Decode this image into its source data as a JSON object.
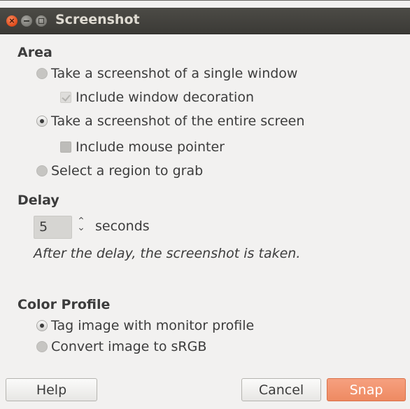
{
  "window": {
    "title": "Screenshot",
    "controls": {
      "close_glyph": "×",
      "close": "close-icon",
      "minimize": "minimize-icon",
      "maximize": "maximize-icon"
    }
  },
  "area": {
    "heading": "Area",
    "options": [
      {
        "label": "Take a screenshot of a single window",
        "type": "radio",
        "selected": false,
        "enabled": true
      },
      {
        "label": "Include window decoration",
        "type": "checkbox",
        "checked": true,
        "enabled": false
      },
      {
        "label": "Take a screenshot of the entire screen",
        "type": "radio",
        "selected": true,
        "enabled": true
      },
      {
        "label": "Include mouse pointer",
        "type": "checkbox",
        "checked": false,
        "enabled": true
      },
      {
        "label": "Select a region to grab",
        "type": "radio",
        "selected": false,
        "enabled": true
      }
    ]
  },
  "delay": {
    "heading": "Delay",
    "value": "5",
    "unit": "seconds",
    "spin_glyph": "⌃⌄",
    "note": "After the delay, the screenshot is taken."
  },
  "color_profile": {
    "heading": "Color Profile",
    "options": [
      {
        "label": "Tag image with monitor profile",
        "type": "radio",
        "selected": true
      },
      {
        "label": "Convert image to sRGB",
        "type": "radio",
        "selected": false
      }
    ]
  },
  "buttons": {
    "help": "Help",
    "cancel": "Cancel",
    "snap": "Snap"
  },
  "colors": {
    "titlebar": "#3e3d39",
    "accent_button": "#f0906a",
    "window_bg": "#f2f1f0"
  }
}
